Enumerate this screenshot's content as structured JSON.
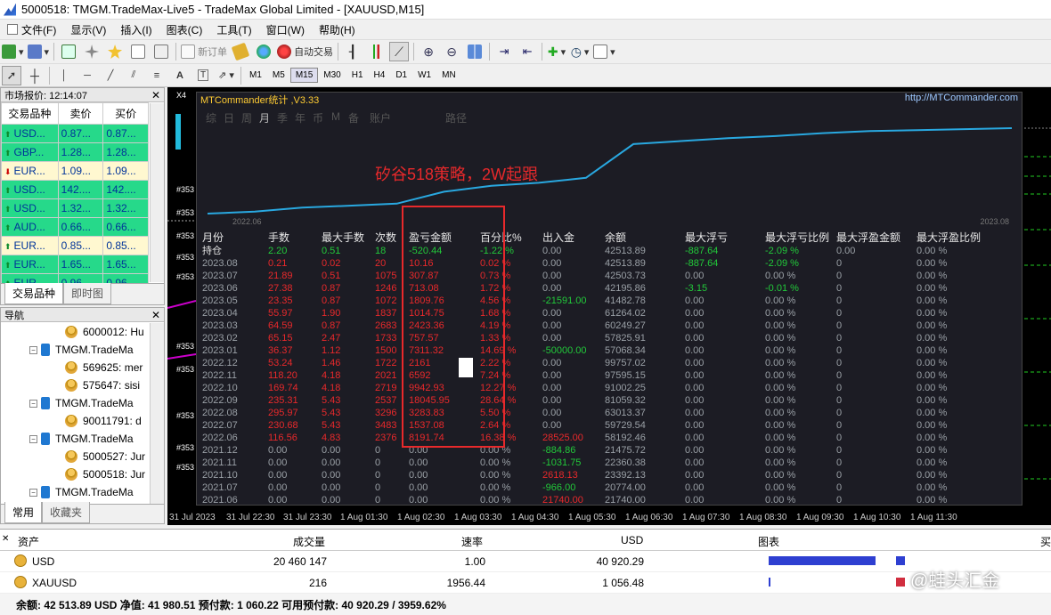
{
  "window": {
    "title": "5000518: TMGM.TradeMax-Live5 - TradeMax Global Limited - [XAUUSD,M15]"
  },
  "menu": [
    "文件(F)",
    "显示(V)",
    "插入(I)",
    "图表(C)",
    "工具(T)",
    "窗口(W)",
    "帮助(H)"
  ],
  "toolbar": {
    "new_order": "新订单",
    "auto_trading": "自动交易"
  },
  "timeframes": [
    "M1",
    "M5",
    "M15",
    "M30",
    "H1",
    "H4",
    "D1",
    "W1",
    "MN"
  ],
  "timeframe_active": "M15",
  "market_watch": {
    "title": "市场报价: 12:14:07",
    "headers": [
      "交易品种",
      "卖价",
      "买价"
    ],
    "rows": [
      {
        "symbol": "USD...",
        "bid": "0.87...",
        "ask": "0.87..."
      },
      {
        "symbol": "GBP...",
        "bid": "1.28...",
        "ask": "1.28..."
      },
      {
        "symbol": "EUR...",
        "bid": "1.09...",
        "ask": "1.09..."
      },
      {
        "symbol": "USD...",
        "bid": "142....",
        "ask": "142...."
      },
      {
        "symbol": "USD...",
        "bid": "1.32...",
        "ask": "1.32..."
      },
      {
        "symbol": "AUD...",
        "bid": "0.66...",
        "ask": "0.66..."
      },
      {
        "symbol": "EUR...",
        "bid": "0.85...",
        "ask": "0.85..."
      },
      {
        "symbol": "EUR...",
        "bid": "1.65...",
        "ask": "1.65..."
      },
      {
        "symbol": "EUR",
        "bid": "0.96",
        "ask": "0.96"
      }
    ],
    "tabs": [
      "交易品种",
      "即时图"
    ]
  },
  "navigator": {
    "title": "导航",
    "items": [
      {
        "type": "account",
        "text": "6000012: Hu"
      },
      {
        "type": "broker",
        "text": "TMGM.TradeMa"
      },
      {
        "type": "account",
        "text": "569625: mer"
      },
      {
        "type": "account",
        "text": "575647: sisi"
      },
      {
        "type": "broker",
        "text": "TMGM.TradeMa"
      },
      {
        "type": "account",
        "text": "90011791: d"
      },
      {
        "type": "broker",
        "text": "TMGM.TradeMa"
      },
      {
        "type": "account",
        "text": "5000527: Jur"
      },
      {
        "type": "account",
        "text": "5000518: Jur"
      },
      {
        "type": "broker",
        "text": "TMGM.TradeMa"
      }
    ],
    "tabs": [
      "常用",
      "收藏夹"
    ]
  },
  "chart": {
    "strip_labels": [
      "X4",
      "#353",
      "#353",
      "#353",
      "#353",
      "#353",
      "#353",
      "#353",
      "#353",
      "#353",
      "#353"
    ],
    "time_labels": [
      "31 Jul 2023",
      "31 Jul 22:30",
      "31 Jul 23:30",
      "1 Aug 01:30",
      "1 Aug 02:30",
      "1 Aug 03:30",
      "1 Aug 04:30",
      "1 Aug 05:30",
      "1 Aug 06:30",
      "1 Aug 07:30",
      "1 Aug 08:30",
      "1 Aug 09:30",
      "1 Aug 10:30",
      "1 Aug 11:30"
    ]
  },
  "commander": {
    "title": "MTCommander统计 ,V3.33",
    "url": "http://MTCommander.com",
    "tabs": [
      "综",
      "日",
      "周",
      "月",
      "季",
      "年",
      "币",
      "M",
      "备",
      "账户",
      "路径"
    ],
    "active_tab": "月",
    "equity_start_label": "2022.06",
    "equity_end_label": "2023.08",
    "annotation": "矽谷518策略，2W起跟",
    "headers": [
      "月份",
      "手数",
      "最大手数",
      "次数",
      "盈亏金额",
      "百分比%",
      "出入金",
      "余额",
      "最大浮亏",
      "最大浮亏比例",
      "最大浮盈金额",
      "最大浮盈比例"
    ],
    "rows": [
      [
        "持仓",
        "2.20",
        "0.51",
        "18",
        "-520.44",
        "-1.22 %",
        "0.00",
        "42513.89",
        "-887.64",
        "-2.09 %",
        "0.00",
        "0.00 %"
      ],
      [
        "2023.08",
        "0.21",
        "0.02",
        "20",
        "10.16",
        "0.02 %",
        "0.00",
        "42513.89",
        "-887.64",
        "-2.09 %",
        "0",
        "0.00 %"
      ],
      [
        "2023.07",
        "21.89",
        "0.51",
        "1075",
        "307.87",
        "0.73 %",
        "0.00",
        "42503.73",
        "0.00",
        "0.00 %",
        "0",
        "0.00 %"
      ],
      [
        "2023.06",
        "27.38",
        "0.87",
        "1246",
        "713.08",
        "1.72 %",
        "0.00",
        "42195.86",
        "-3.15",
        "-0.01 %",
        "0",
        "0.00 %"
      ],
      [
        "2023.05",
        "23.35",
        "0.87",
        "1072",
        "1809.76",
        "4.56 %",
        "-21591.00",
        "41482.78",
        "0.00",
        "0.00 %",
        "0",
        "0.00 %"
      ],
      [
        "2023.04",
        "55.97",
        "1.90",
        "1837",
        "1014.75",
        "1.68 %",
        "0.00",
        "61264.02",
        "0.00",
        "0.00 %",
        "0",
        "0.00 %"
      ],
      [
        "2023.03",
        "64.59",
        "0.87",
        "2683",
        "2423.36",
        "4.19 %",
        "0.00",
        "60249.27",
        "0.00",
        "0.00 %",
        "0",
        "0.00 %"
      ],
      [
        "2023.02",
        "65.15",
        "2.47",
        "1733",
        "757.57",
        "1.33 %",
        "0.00",
        "57825.91",
        "0.00",
        "0.00 %",
        "0",
        "0.00 %"
      ],
      [
        "2023.01",
        "36.37",
        "1.12",
        "1500",
        "7311.32",
        "14.69 %",
        "-50000.00",
        "57068.34",
        "0.00",
        "0.00 %",
        "0",
        "0.00 %"
      ],
      [
        "2022.12",
        "53.24",
        "1.46",
        "1722",
        "2161",
        "2.22 %",
        "0.00",
        "99757.02",
        "0.00",
        "0.00 %",
        "0",
        "0.00 %"
      ],
      [
        "2022.11",
        "118.20",
        "4.18",
        "2021",
        "6592",
        "7.24 %",
        "0.00",
        "97595.15",
        "0.00",
        "0.00 %",
        "0",
        "0.00 %"
      ],
      [
        "2022.10",
        "169.74",
        "4.18",
        "2719",
        "9942.93",
        "12.27 %",
        "0.00",
        "91002.25",
        "0.00",
        "0.00 %",
        "0",
        "0.00 %"
      ],
      [
        "2022.09",
        "235.31",
        "5.43",
        "2537",
        "18045.95",
        "28.64 %",
        "0.00",
        "81059.32",
        "0.00",
        "0.00 %",
        "0",
        "0.00 %"
      ],
      [
        "2022.08",
        "295.97",
        "5.43",
        "3296",
        "3283.83",
        "5.50 %",
        "0.00",
        "63013.37",
        "0.00",
        "0.00 %",
        "0",
        "0.00 %"
      ],
      [
        "2022.07",
        "230.68",
        "5.43",
        "3483",
        "1537.08",
        "2.64 %",
        "0.00",
        "59729.54",
        "0.00",
        "0.00 %",
        "0",
        "0.00 %"
      ],
      [
        "2022.06",
        "116.56",
        "4.83",
        "2376",
        "8191.74",
        "16.38 %",
        "28525.00",
        "58192.46",
        "0.00",
        "0.00 %",
        "0",
        "0.00 %"
      ],
      [
        "2021.12",
        "0.00",
        "0.00",
        "0",
        "0.00",
        "0.00 %",
        "-884.86",
        "21475.72",
        "0.00",
        "0.00 %",
        "0",
        "0.00 %"
      ],
      [
        "2021.11",
        "0.00",
        "0.00",
        "0",
        "0.00",
        "0.00 %",
        "-1031.75",
        "22360.38",
        "0.00",
        "0.00 %",
        "0",
        "0.00 %"
      ],
      [
        "2021.10",
        "0.00",
        "0.00",
        "0",
        "0.00",
        "0.00 %",
        "2618.13",
        "23392.13",
        "0.00",
        "0.00 %",
        "0",
        "0.00 %"
      ],
      [
        "2021.07",
        "0.00",
        "0.00",
        "0",
        "0.00",
        "0.00 %",
        "-966.00",
        "20774.00",
        "0.00",
        "0.00 %",
        "0",
        "0.00 %"
      ],
      [
        "2021.06",
        "0.00",
        "0.00",
        "0",
        "0.00",
        "0.00 %",
        "21740.00",
        "21740.00",
        "0.00",
        "0.00 %",
        "0",
        "0.00 %"
      ]
    ],
    "equity_curve": [
      0,
      2,
      6,
      8,
      10,
      22,
      28,
      31,
      36,
      70,
      73,
      76,
      78,
      81,
      83,
      84,
      85,
      86
    ]
  },
  "terminal": {
    "headers": [
      "资产",
      "成交量",
      "速率",
      "USD",
      "图表",
      "买"
    ],
    "rows": [
      {
        "asset": "USD",
        "volume": "20 460 147",
        "rate": "1.00",
        "usd": "40 920.29",
        "bar_fraction": 0.98
      },
      {
        "asset": "XAUUSD",
        "volume": "216",
        "rate": "1956.44",
        "usd": "1 056.48",
        "bar_fraction": 0.02
      }
    ],
    "balance_line": "余额: 42 513.89 USD  净值: 41 980.51  预付款: 1 060.22  可用预付款: 40 920.29 / 3959.62%"
  },
  "watermark": "@蛙头汇金",
  "colors": {
    "profit_red": "#e8292b",
    "green": "#22c93a",
    "grey": "#9aa0a6",
    "curve": "#29a8e0"
  }
}
